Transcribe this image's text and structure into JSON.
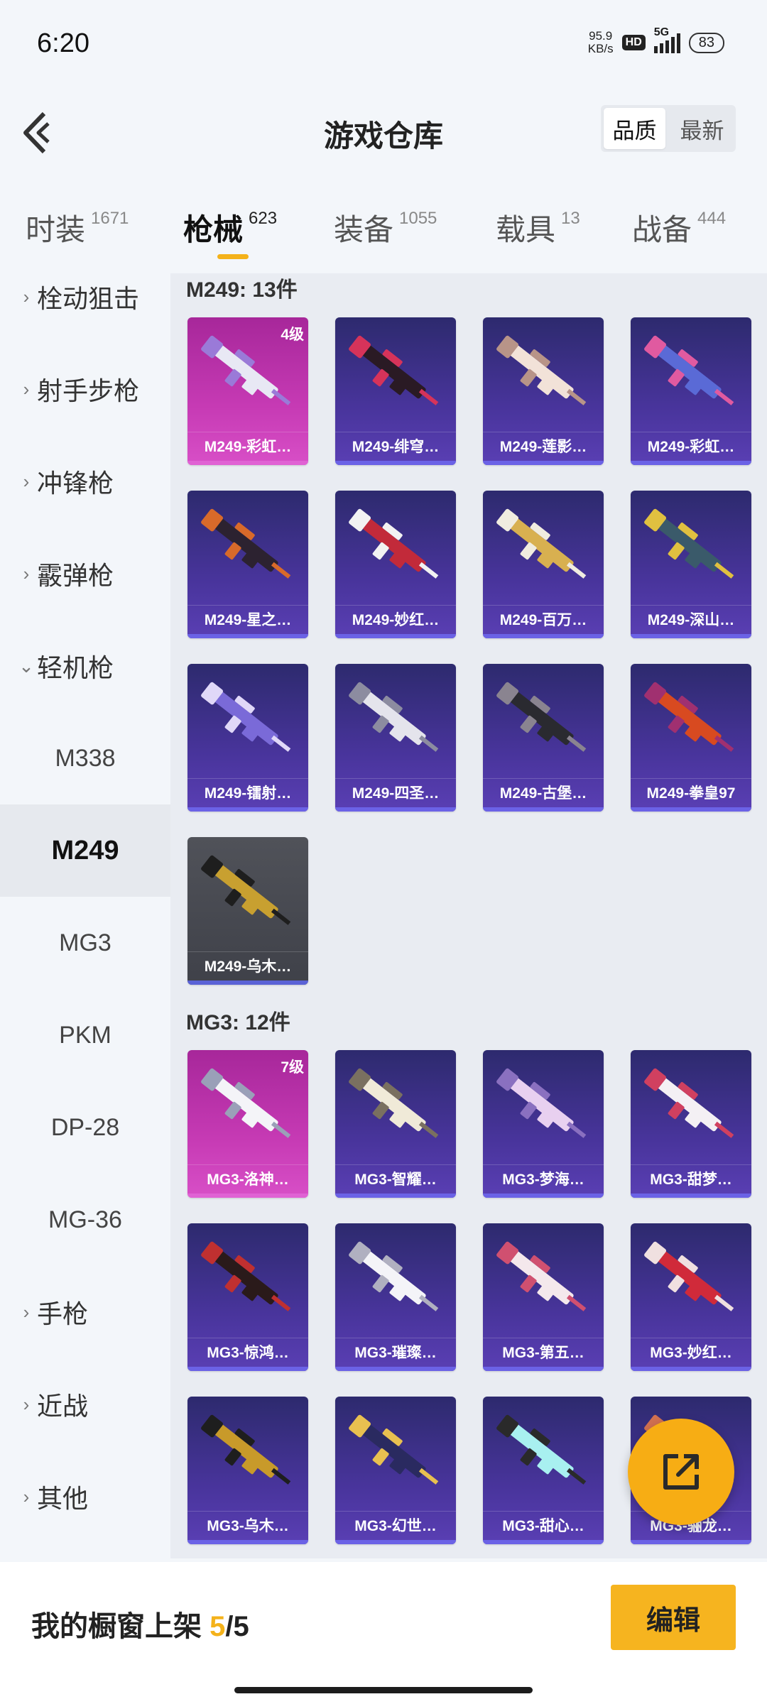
{
  "status_bar": {
    "time": "6:20",
    "net_speed": "95.9",
    "net_unit": "KB/s",
    "hd": "HD",
    "network": "5G",
    "battery": "83"
  },
  "header": {
    "title": "游戏仓库",
    "sort_options": [
      "品质",
      "最新"
    ],
    "active_sort": "品质"
  },
  "tabs": [
    {
      "label": "时装",
      "count": "1671"
    },
    {
      "label": "枪械",
      "count": "623",
      "active": true
    },
    {
      "label": "装备",
      "count": "1055"
    },
    {
      "label": "载具",
      "count": "13"
    },
    {
      "label": "战备",
      "count": "444"
    }
  ],
  "sidebar": {
    "items": [
      {
        "label": "栓动狙击"
      },
      {
        "label": "射手步枪"
      },
      {
        "label": "冲锋枪"
      },
      {
        "label": "霰弹枪"
      },
      {
        "label": "轻机枪",
        "expanded": true
      },
      {
        "label": "M338"
      },
      {
        "label": "M249",
        "selected": true
      },
      {
        "label": "MG3"
      },
      {
        "label": "PKM"
      },
      {
        "label": "DP-28"
      },
      {
        "label": "MG-36"
      },
      {
        "label": "手枪"
      },
      {
        "label": "近战"
      },
      {
        "label": "其他"
      }
    ]
  },
  "groups": [
    {
      "title": "M249: 13件",
      "items": [
        {
          "name": "M249-彩虹…",
          "level": "4级"
        },
        {
          "name": "M249-绯穹…"
        },
        {
          "name": "M249-莲影…"
        },
        {
          "name": "M249-彩虹…"
        },
        {
          "name": "M249-星之…"
        },
        {
          "name": "M249-妙红…"
        },
        {
          "name": "M249-百万…"
        },
        {
          "name": "M249-深山…"
        },
        {
          "name": "M249-镭射…"
        },
        {
          "name": "M249-四圣…"
        },
        {
          "name": "M249-古堡…"
        },
        {
          "name": "M249-拳皇97"
        },
        {
          "name": "M249-乌木…"
        }
      ]
    },
    {
      "title": "MG3: 12件",
      "items": [
        {
          "name": "MG3-洛神…",
          "level": "7级"
        },
        {
          "name": "MG3-智耀…"
        },
        {
          "name": "MG3-梦海…"
        },
        {
          "name": "MG3-甜梦…"
        },
        {
          "name": "MG3-惊鸿…"
        },
        {
          "name": "MG3-璀璨…"
        },
        {
          "name": "MG3-第五…"
        },
        {
          "name": "MG3-妙红…"
        },
        {
          "name": "MG3-乌木…"
        },
        {
          "name": "MG3-幻世…"
        },
        {
          "name": "MG3-甜心…"
        },
        {
          "name": "MG3-骊龙…"
        }
      ]
    }
  ],
  "bottom": {
    "showcase_label": "我的橱窗上架",
    "showcase_current": "5",
    "showcase_sep": "/",
    "showcase_total": "5",
    "edit_label": "编辑"
  },
  "colors": {
    "accent": "#f4b21a",
    "card_purple": "#48349b",
    "card_pink": "#c63ab4",
    "card_gray": "#505259"
  },
  "fab_icon": "share-external-icon"
}
